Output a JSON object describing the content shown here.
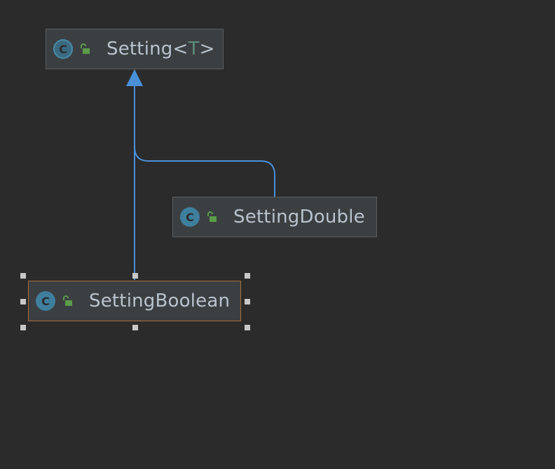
{
  "diagram": {
    "nodes": {
      "setting": {
        "name": "Setting",
        "lt": "<",
        "type_param": "T",
        "gt": ">",
        "icon": "class-icon-abstract",
        "visibility_icon": "lock-open-icon"
      },
      "setting_double": {
        "name": "SettingDouble",
        "icon": "class-icon",
        "visibility_icon": "lock-open-icon"
      },
      "setting_boolean": {
        "name": "SettingBoolean",
        "icon": "class-icon",
        "visibility_icon": "lock-open-icon",
        "selected": true
      }
    },
    "edges": [
      {
        "from": "SettingDouble",
        "to": "Setting<T>",
        "kind": "inheritance"
      },
      {
        "from": "SettingBoolean",
        "to": "Setting<T>",
        "kind": "inheritance"
      }
    ],
    "class_icon_letter": "C",
    "colors": {
      "background": "#2b2b2b",
      "node_fill": "#3c3f41",
      "edge": "#4a90d9",
      "selection_border": "#a86e3a",
      "type_param": "#5f8c7b"
    }
  }
}
